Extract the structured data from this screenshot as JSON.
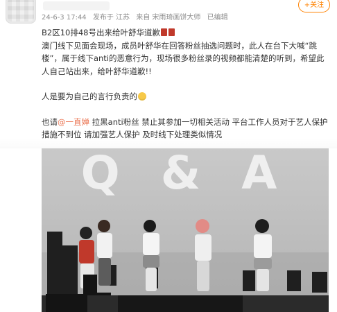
{
  "post": {
    "date": "24-6-3 17:44",
    "published_in": "发布于 江苏",
    "source": "来自 宋雨琦画饼大师",
    "edited": "已编辑",
    "follow_label": "+关注",
    "line1": "B2区10排48号出来给叶舒华道歉",
    "body_para": "澳门线下见面会现场，成员叶舒华在回答粉丝抽选问题时，此人在台下大喊“跳楼”，属于线下anti的恶意行为，现场很多粉丝录的视频都能清楚的听到，希望此人自己站出来，给叶舒华道歉!!",
    "para2": "人是要为自己的言行负责的",
    "para3_prefix": "也请",
    "mention": "@一直婵",
    "para3_suffix": " 拉黑anti粉丝 禁止其参加一切相关活动 平台工作人员对于艺人保护措施不到位 请加强艺人保护 及时线下处理类似情况"
  },
  "photo": {
    "backdrop_text": "Q & A"
  },
  "colors": {
    "accent": "#ff8200",
    "mention": "#eb7350",
    "meta_text": "#8c8c8c"
  }
}
